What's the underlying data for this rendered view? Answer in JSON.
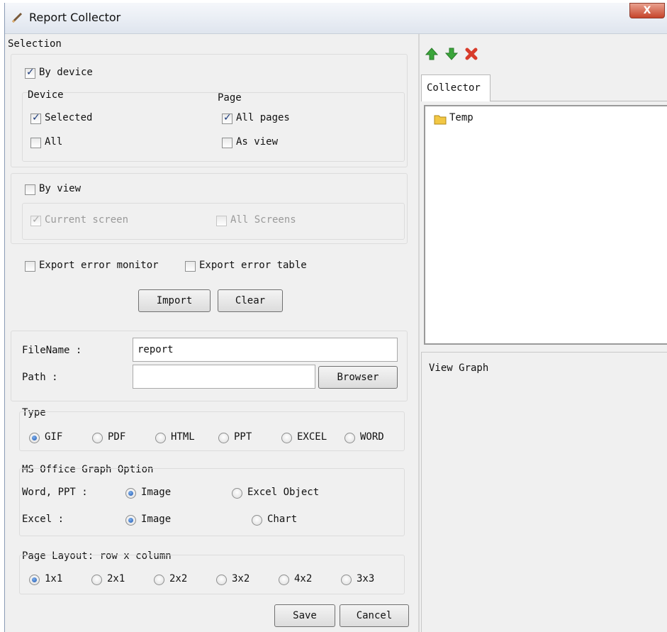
{
  "window": {
    "title": "Report Collector",
    "close_label": "X"
  },
  "selection": {
    "legend": "Selection",
    "by_device": {
      "label": "By device",
      "checked": true
    },
    "device": {
      "heading": "Device",
      "selected": {
        "label": "Selected",
        "checked": true
      },
      "all": {
        "label": "All",
        "checked": false
      }
    },
    "page": {
      "heading": "Page",
      "all_pages": {
        "label": "All pages",
        "checked": true
      },
      "as_view": {
        "label": "As view",
        "checked": false
      }
    },
    "by_view": {
      "label": "By view",
      "checked": false
    },
    "current_screen": {
      "label": "Current screen",
      "checked": true
    },
    "all_screens": {
      "label": "All Screens",
      "checked": false
    },
    "export_error_monitor": {
      "label": "Export error monitor",
      "checked": false
    },
    "export_error_table": {
      "label": "Export error table",
      "checked": false
    },
    "import_label": "Import",
    "clear_label": "Clear"
  },
  "file": {
    "filename_label": "FileName :",
    "filename_value": "report",
    "path_label": "Path :",
    "path_value": "",
    "browser_label": "Browser"
  },
  "type": {
    "legend": "Type",
    "options": [
      "GIF",
      "PDF",
      "HTML",
      "PPT",
      "EXCEL",
      "WORD"
    ],
    "selected": "GIF"
  },
  "ms_office": {
    "legend": "MS Office Graph Option",
    "word_ppt_label": "Word, PPT :",
    "word_ppt_options": [
      "Image",
      "Excel Object"
    ],
    "word_ppt_selected": "Image",
    "excel_label": "Excel :",
    "excel_options": [
      "Image",
      "Chart"
    ],
    "excel_selected": "Image"
  },
  "layout": {
    "legend": "Page Layout: row x column",
    "options": [
      "1x1",
      "2x1",
      "2x2",
      "3x2",
      "4x2",
      "3x3"
    ],
    "selected": "1x1"
  },
  "footer": {
    "save_label": "Save",
    "cancel_label": "Cancel"
  },
  "collector": {
    "toolbar": {
      "up_icon": "arrow-up-icon",
      "down_icon": "arrow-down-icon",
      "delete_icon": "delete-x-icon"
    },
    "tab_label": "Collector",
    "tree_items": [
      "Temp"
    ],
    "view_graph_label": "View Graph"
  },
  "colors": {
    "arrow_green": "#3aa53a",
    "delete_red": "#d83b2a",
    "folder_yellow": "#f2c744"
  }
}
